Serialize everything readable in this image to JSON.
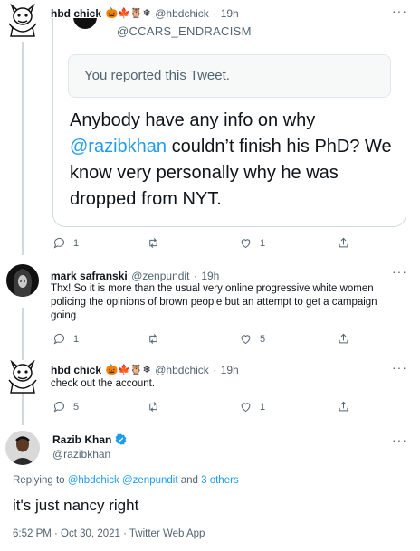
{
  "tweets": [
    {
      "name": "hbd chick",
      "badges": "🎃🍁🦉❄",
      "handle": "@hbdchick",
      "time": "19h",
      "quoted": {
        "header": "@CCARS_ENDRACISM",
        "notice": "You reported this Tweet.",
        "text_before": "Anybody have any info on why ",
        "mention": "@razibkhan",
        "text_after": " couldn’t finish his PhD? We know very personally why he was dropped from NYT."
      },
      "stats": {
        "replies": "1",
        "likes": "1"
      }
    },
    {
      "name": "mark safranski",
      "handle": "@zenpundit",
      "time": "19h",
      "text": "Thx! So it is more than the usual very online progressive white women policing the opinions of brown people  but an attempt to get a campaign going",
      "stats": {
        "replies": "1",
        "likes": "5"
      }
    },
    {
      "name": "hbd chick",
      "badges": "🎃🍁🦉❄",
      "handle": "@hbdchick",
      "time": "19h",
      "text": "check out the account.",
      "stats": {
        "replies": "5",
        "likes": "1"
      }
    }
  ],
  "main": {
    "name": "Razib",
    "name2": "Khan",
    "handle": "@razibkhan",
    "replying_prefix": "Replying to ",
    "replying_to": "@hbdchick @zenpundit",
    "replying_and": " and ",
    "replying_others": "3 others",
    "text": "it's just nancy right",
    "meta": "6:52 PM · Oct 30, 2021 · Twitter Web App"
  },
  "separator": "·",
  "more_glyph": "···",
  "colors": {
    "accent": "#1d9bf0",
    "muted": "#536471",
    "border": "#cfd9de"
  }
}
